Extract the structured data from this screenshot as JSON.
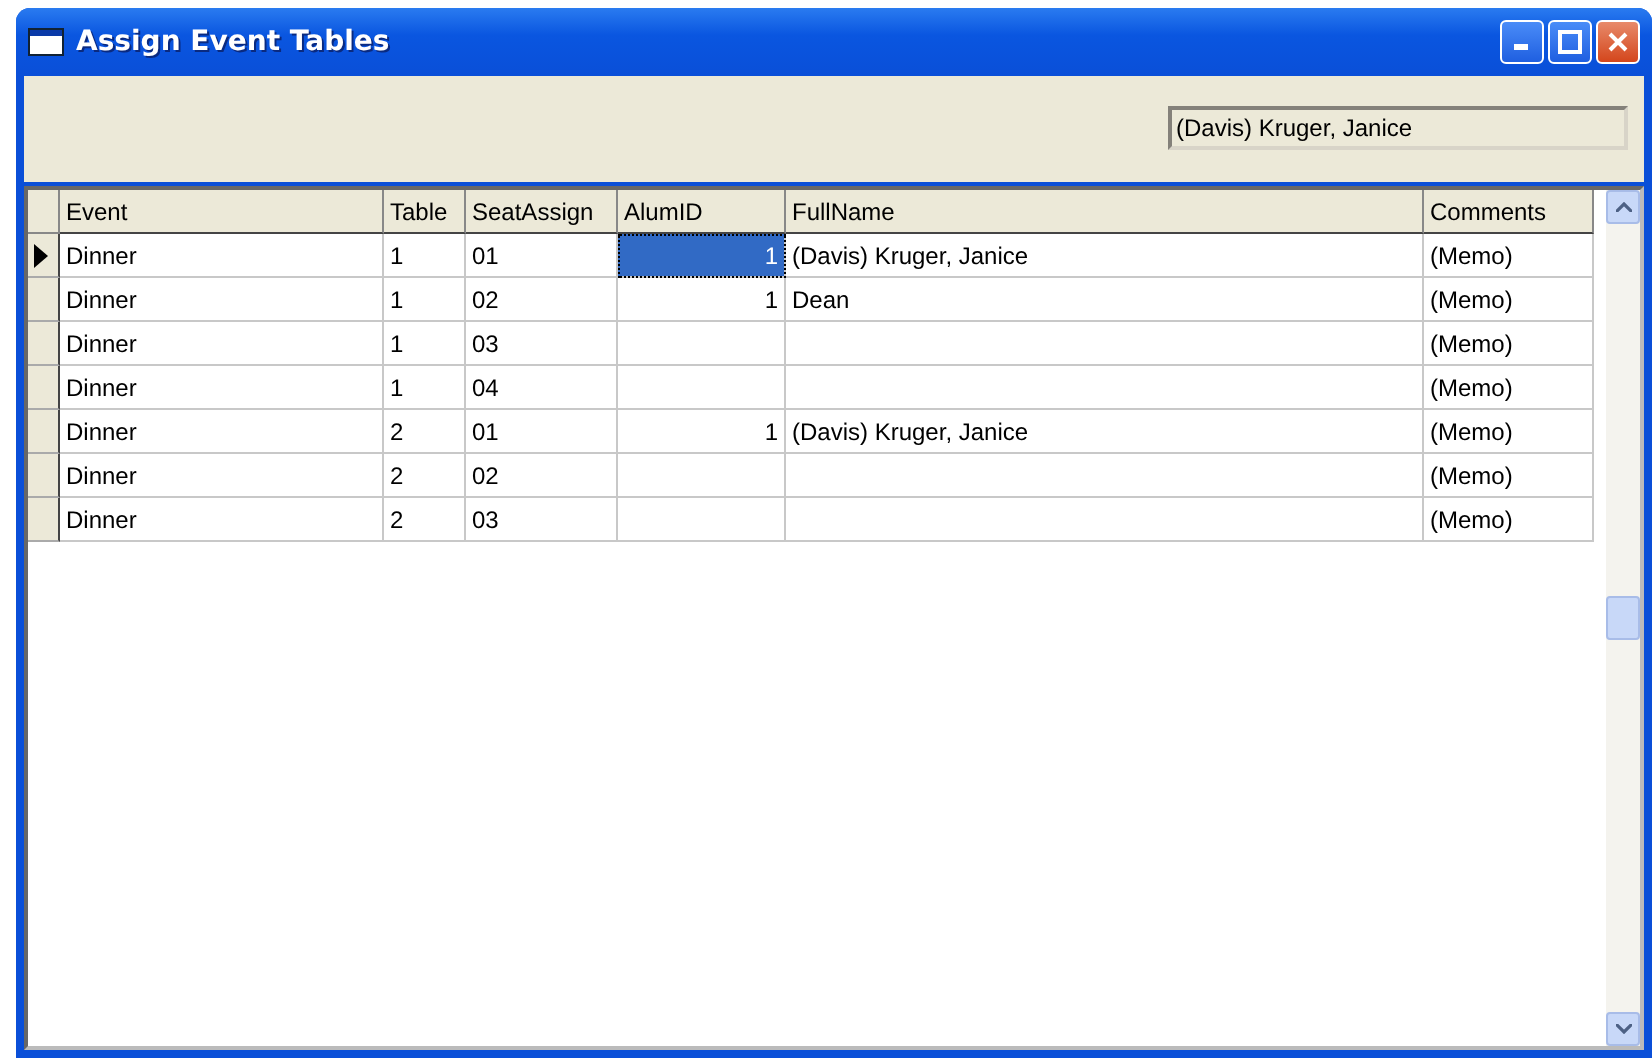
{
  "window": {
    "title": "Assign Event Tables"
  },
  "name_field": {
    "value": "(Davis) Kruger, Janice"
  },
  "table": {
    "columns": [
      {
        "label": "Event",
        "kind": "text",
        "focused": false
      },
      {
        "label": "Table",
        "kind": "text",
        "focused": false
      },
      {
        "label": "SeatAssign",
        "kind": "text",
        "focused": false
      },
      {
        "label": "AlumID",
        "kind": "number",
        "focused": true
      },
      {
        "label": "FullName",
        "kind": "text",
        "focused": false
      },
      {
        "label": "Comments",
        "kind": "text",
        "focused": false
      }
    ],
    "rows": [
      {
        "selected": true,
        "cells": [
          "Dinner",
          "1",
          "01",
          "1",
          "(Davis) Kruger, Janice",
          "(Memo)"
        ]
      },
      {
        "selected": false,
        "cells": [
          "Dinner",
          "1",
          "02",
          "1",
          "Dean",
          "(Memo)"
        ]
      },
      {
        "selected": false,
        "cells": [
          "Dinner",
          "1",
          "03",
          "",
          "",
          "(Memo)"
        ]
      },
      {
        "selected": false,
        "cells": [
          "Dinner",
          "1",
          "04",
          "",
          "",
          "(Memo)"
        ]
      },
      {
        "selected": false,
        "cells": [
          "Dinner",
          "2",
          "01",
          "1",
          "(Davis) Kruger, Janice",
          "(Memo)"
        ]
      },
      {
        "selected": false,
        "cells": [
          "Dinner",
          "2",
          "02",
          "",
          "",
          "(Memo)"
        ]
      },
      {
        "selected": false,
        "cells": [
          "Dinner",
          "2",
          "03",
          "",
          "",
          "(Memo)"
        ]
      }
    ]
  }
}
